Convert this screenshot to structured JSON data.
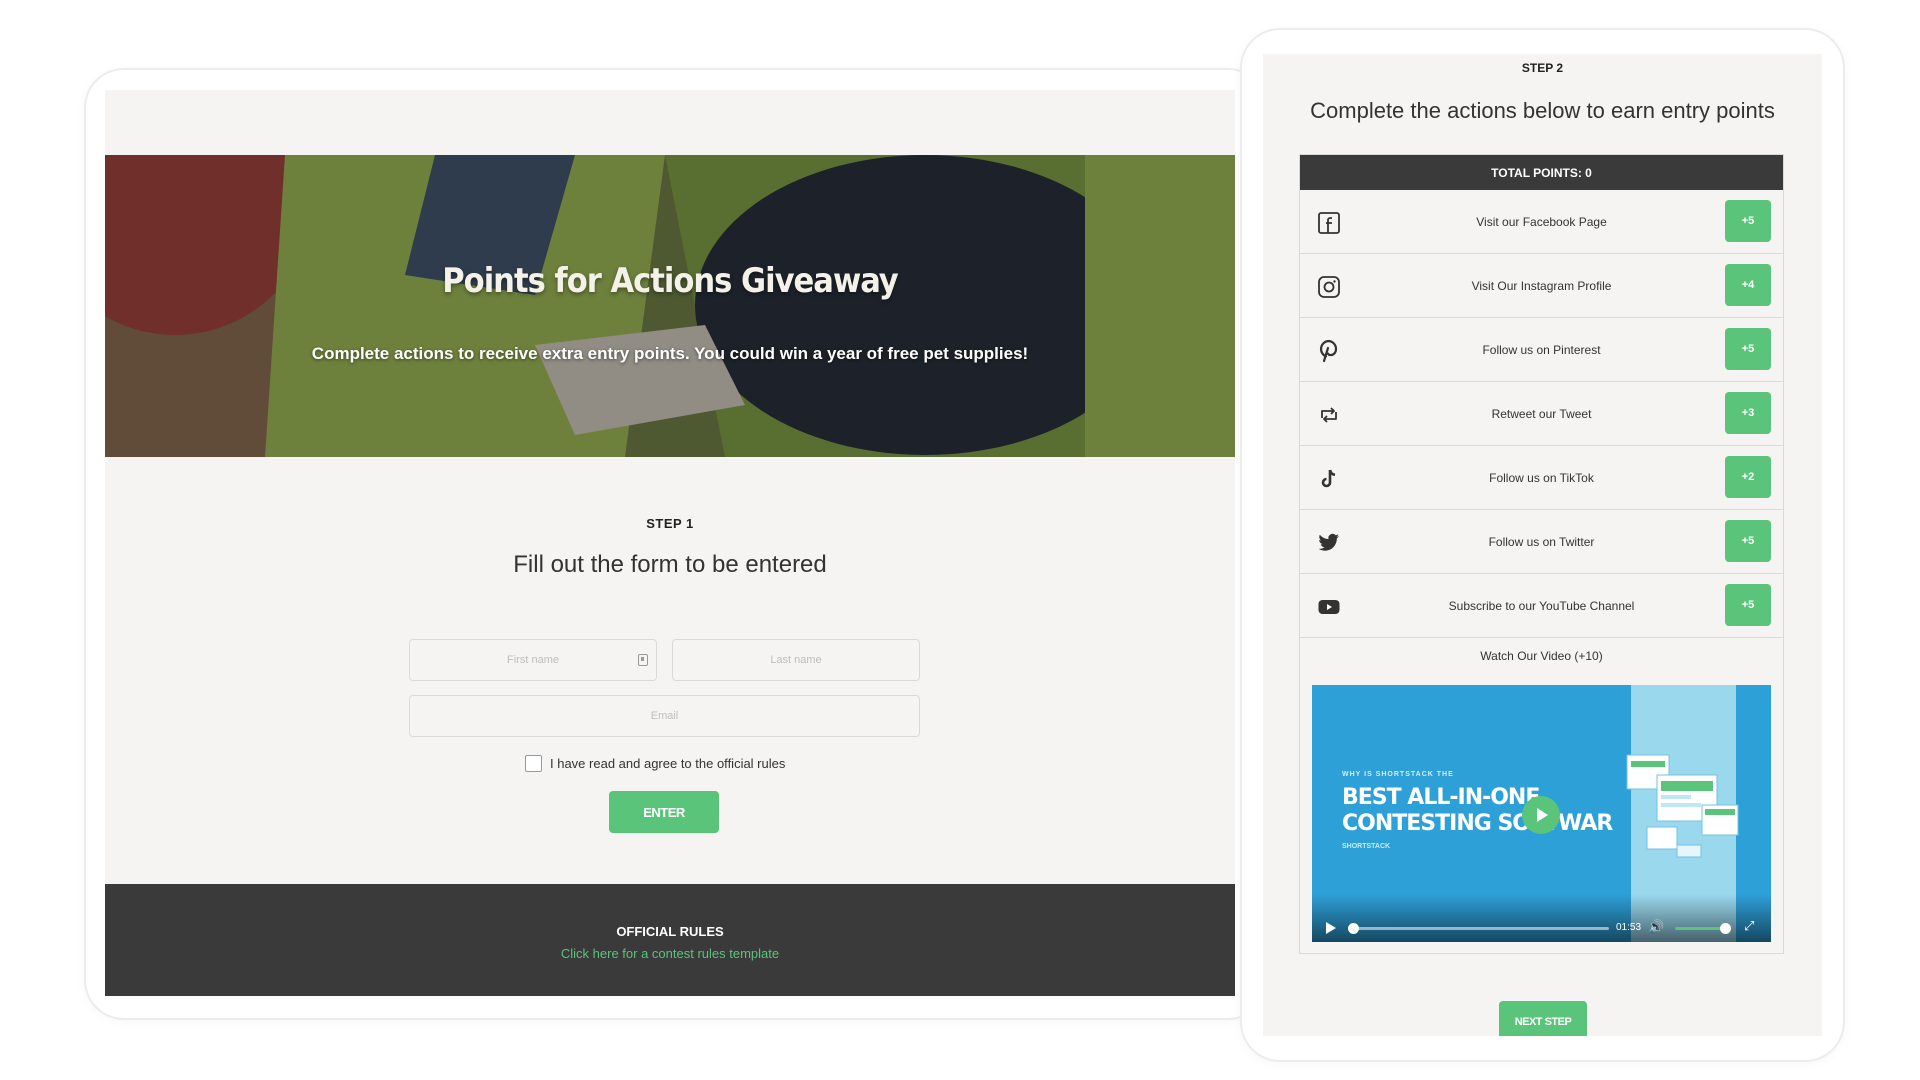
{
  "hero": {
    "title": "Points for Actions Giveaway",
    "subtitle": "Complete actions to receive extra entry points. You could win a year of free pet supplies!"
  },
  "step1": {
    "label": "STEP 1",
    "heading": "Fill out the form to be entered",
    "fields": {
      "first_name_placeholder": "First name",
      "last_name_placeholder": "Last name",
      "email_placeholder": "Email"
    },
    "agree_label": "I have read and agree to the official rules",
    "enter_label": "ENTER"
  },
  "footer": {
    "rules_title": "OFFICIAL RULES",
    "rules_link": "Click here for a contest rules template"
  },
  "step2": {
    "label": "STEP 2",
    "heading": "Complete the actions below to earn entry points",
    "total_points": "TOTAL POINTS: 0",
    "actions": [
      {
        "icon": "facebook-icon",
        "label": "Visit our Facebook Page",
        "points": "+5"
      },
      {
        "icon": "instagram-icon",
        "label": "Visit Our Instagram Profile",
        "points": "+4"
      },
      {
        "icon": "pinterest-icon",
        "label": "Follow us on Pinterest",
        "points": "+5"
      },
      {
        "icon": "retweet-icon",
        "label": "Retweet our Tweet",
        "points": "+3"
      },
      {
        "icon": "tiktok-icon",
        "label": "Follow us on TikTok",
        "points": "+2"
      },
      {
        "icon": "twitter-icon",
        "label": "Follow us on Twitter",
        "points": "+5"
      },
      {
        "icon": "youtube-icon",
        "label": "Subscribe to our YouTube Channel",
        "points": "+5"
      }
    ],
    "watch_label": "Watch Our Video (+10)",
    "video": {
      "kicker": "WHY IS SHORTSTACK THE",
      "title_line1": "BEST ALL-IN-ONE",
      "title_line2": "CONTESTING SOFTWAR",
      "brand": "SHORTSTACK",
      "time": "01:53",
      "progress": 0.0,
      "volume": 0.85
    },
    "next_label": "NEXT STEP"
  },
  "colors": {
    "accent_green": "#59c47a",
    "dark_bar": "#3a3a3a",
    "screen_bg": "#f5f4f2",
    "video_blue": "#2ea0d8"
  }
}
